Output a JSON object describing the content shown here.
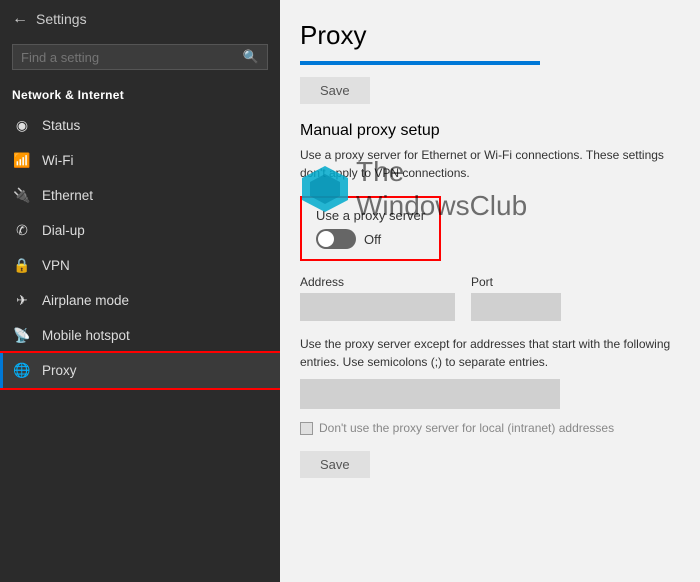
{
  "sidebar": {
    "back_label": "←",
    "title": "Settings",
    "search_placeholder": "Find a setting",
    "section_title": "Network & Internet",
    "items": [
      {
        "id": "status",
        "label": "Status",
        "icon": "⊙"
      },
      {
        "id": "wifi",
        "label": "Wi-Fi",
        "icon": "📶"
      },
      {
        "id": "ethernet",
        "label": "Ethernet",
        "icon": "🔌"
      },
      {
        "id": "dialup",
        "label": "Dial-up",
        "icon": "☎"
      },
      {
        "id": "vpn",
        "label": "VPN",
        "icon": "🔒"
      },
      {
        "id": "airplane",
        "label": "Airplane mode",
        "icon": "✈"
      },
      {
        "id": "hotspot",
        "label": "Mobile hotspot",
        "icon": "📡"
      },
      {
        "id": "proxy",
        "label": "Proxy",
        "icon": "🌐"
      }
    ]
  },
  "main": {
    "page_title": "Proxy",
    "save_top_label": "Save",
    "manual_section_title": "Manual proxy setup",
    "manual_section_desc": "Use a proxy server for Ethernet or Wi-Fi connections. These settings don't apply to VPN connections.",
    "toggle_box": {
      "label": "Use a proxy server",
      "state_text": "Off"
    },
    "address_label": "Address",
    "port_label": "Port",
    "address_value": "",
    "port_value": "",
    "exceptions_desc": "Use the proxy server except for addresses that start with the following entries. Use semicolons (;) to separate entries.",
    "exceptions_value": "",
    "checkbox_label": "Don't use the proxy server for local (intranet) addresses",
    "save_bottom_label": "Save"
  }
}
